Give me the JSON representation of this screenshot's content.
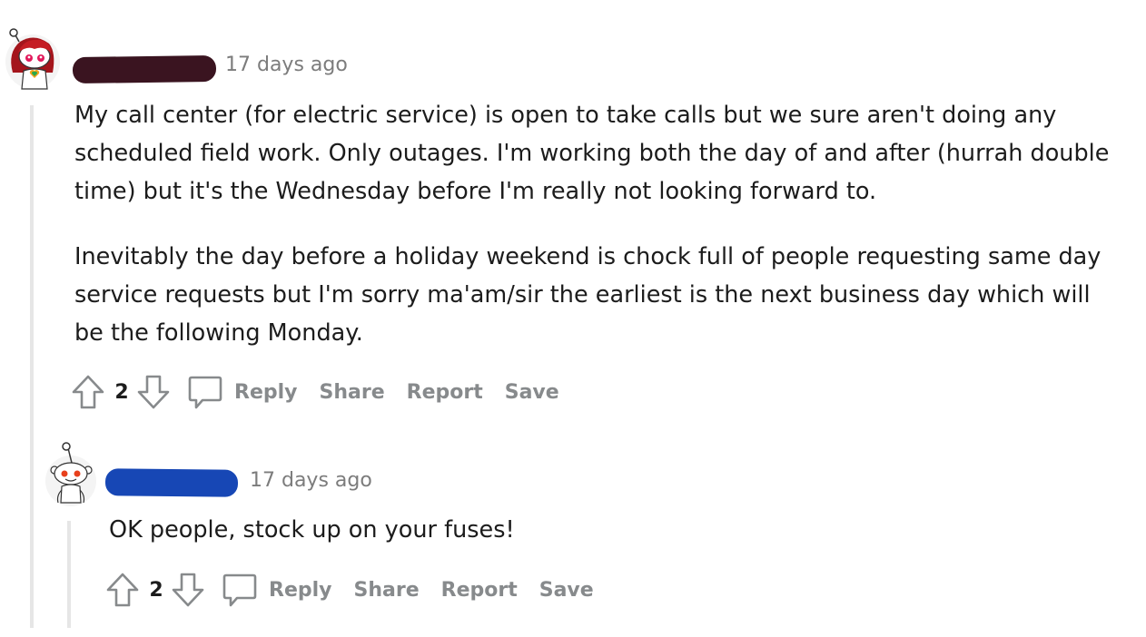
{
  "comments": [
    {
      "timestamp": "17 days ago",
      "paragraphs": [
        "My call center (for electric service) is open to take calls but we sure aren't doing any scheduled field work. Only outages. I'm working both the day of and after (hurrah double time) but it's the Wednesday before I'm really not looking forward to.",
        "Inevitably the day before a holiday weekend is chock full of people requesting same day service requests but I'm sorry ma'am/sir the earliest is the next business day which will be the following Monday."
      ],
      "score": "2",
      "actions": {
        "reply": "Reply",
        "share": "Share",
        "report": "Report",
        "save": "Save"
      },
      "redaction_color": "#3a1420",
      "avatar_icon": "red-hair-snoo-avatar-icon"
    },
    {
      "timestamp": "17 days ago",
      "paragraphs": [
        "OK people, stock up on your fuses!"
      ],
      "score": "2",
      "actions": {
        "reply": "Reply",
        "share": "Share",
        "report": "Report",
        "save": "Save"
      },
      "redaction_color": "#1747b5",
      "avatar_icon": "default-snoo-avatar-icon"
    }
  ]
}
